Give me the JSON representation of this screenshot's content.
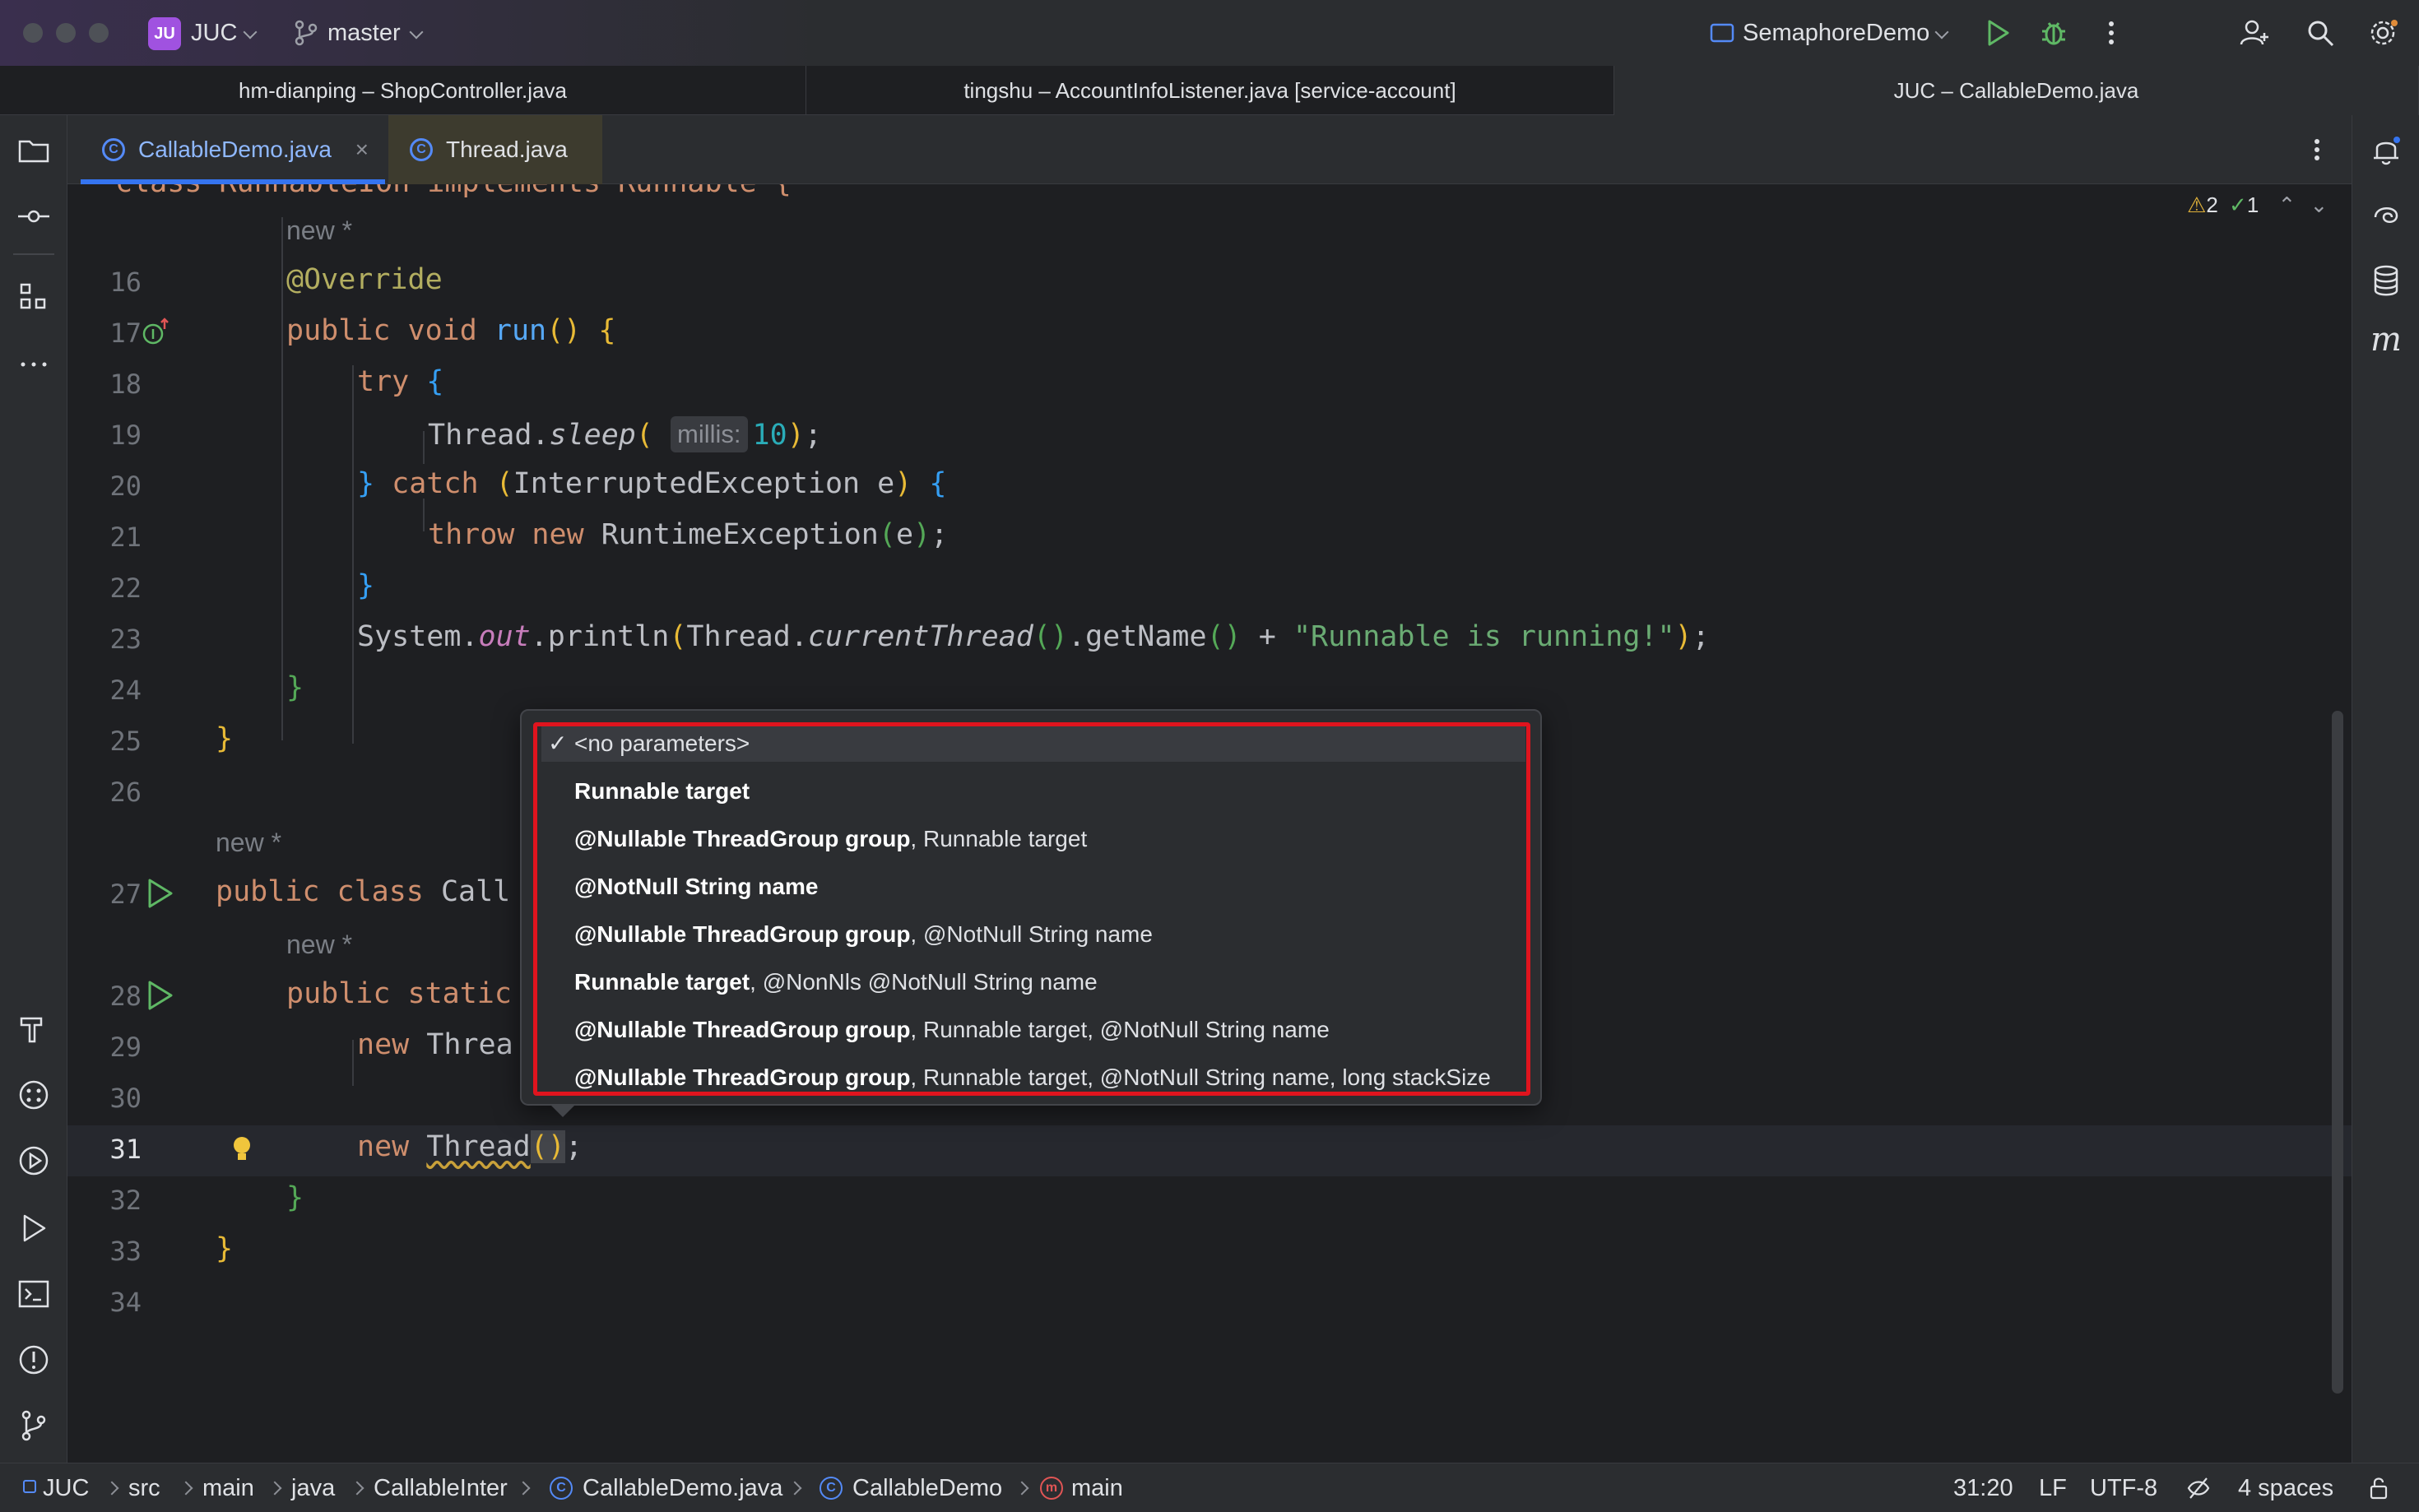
{
  "titlebar": {
    "project_initials": "JU",
    "project_name": "JUC",
    "branch": "master",
    "run_config": "SemaphoreDemo"
  },
  "window_tabs": [
    {
      "label": "hm-dianping – ShopController.java"
    },
    {
      "label": "tingshu – AccountInfoListener.java [service-account]"
    },
    {
      "label": "JUC – CallableDemo.java"
    }
  ],
  "editor_tabs": [
    {
      "label": "CallableDemo.java",
      "icon": "class-icon",
      "close": "×"
    },
    {
      "label": "Thread.java",
      "icon": "class-icon"
    }
  ],
  "inspections": {
    "warnings": "2",
    "weak_warnings": "1"
  },
  "code": {
    "line15_partial": "class RunnableIOn implements Runnable {",
    "new_marker": "new *",
    "lines": [
      {
        "n": "16"
      },
      {
        "n": "17"
      },
      {
        "n": "18"
      },
      {
        "n": "19"
      },
      {
        "n": "20"
      },
      {
        "n": "21"
      },
      {
        "n": "22"
      },
      {
        "n": "23"
      },
      {
        "n": "24"
      },
      {
        "n": "25"
      },
      {
        "n": "26"
      },
      {
        "n": "27"
      },
      {
        "n": "28"
      },
      {
        "n": "29"
      },
      {
        "n": "30"
      },
      {
        "n": "31"
      },
      {
        "n": "32"
      },
      {
        "n": "33"
      },
      {
        "n": "34"
      }
    ],
    "override": "@Override",
    "run_sig_kw": "public void ",
    "run_name": "run",
    "try_kw": "try",
    "thread_sleep_obj": "Thread.",
    "thread_sleep_fn": "sleep",
    "param_hint": "millis:",
    "sleep_arg": "10",
    "catch_kw": "catch",
    "catch_type": "InterruptedException e",
    "throw_kw": "throw new ",
    "runtime_ex": "RuntimeException",
    "runtime_arg": "e",
    "sysout_a": "System.",
    "sysout_field": "out",
    "sysout_b": ".println",
    "current_thread_obj": "Thread.",
    "current_thread_fn": "currentThread",
    "get_name": ".getName",
    "plus": " + ",
    "string_lit": "\"Runnable is running!\"",
    "public_class_kw": "public class ",
    "public_class_name": "Call",
    "public_static_kw": "public static",
    "new_kw": "new ",
    "thread_partial": "Threa",
    "thread_cls": "Thread",
    "cursor_pos": "31:20"
  },
  "popup": {
    "signatures": [
      {
        "bold": "",
        "rest": "<no parameters>",
        "selected": true
      },
      {
        "bold": "Runnable target",
        "rest": ""
      },
      {
        "bold": "@Nullable ThreadGroup group",
        "rest": ", Runnable target"
      },
      {
        "bold": "@NotNull String name",
        "rest": ""
      },
      {
        "bold": "@Nullable ThreadGroup group",
        "rest": ", @NotNull String name"
      },
      {
        "bold": "Runnable target",
        "rest": ", @NonNls @NotNull String name"
      },
      {
        "bold": "@Nullable ThreadGroup group",
        "rest": ", Runnable target, @NotNull String name"
      },
      {
        "bold": "@Nullable ThreadGroup group",
        "rest": ", Runnable target, @NotNull String name, long stackSize"
      }
    ],
    "check_mark": "✓"
  },
  "statusbar": {
    "breadcrumbs": [
      "JUC",
      "src",
      "main",
      "java",
      "CallableInter",
      "CallableDemo.java",
      "CallableDemo",
      "main"
    ],
    "position": "31:20",
    "line_sep": "LF",
    "encoding": "UTF-8",
    "indent": "4 spaces"
  },
  "colors": {
    "accent": "#3574f0",
    "project_badge": "#a052e0",
    "highlight_box": "#e0141e"
  }
}
